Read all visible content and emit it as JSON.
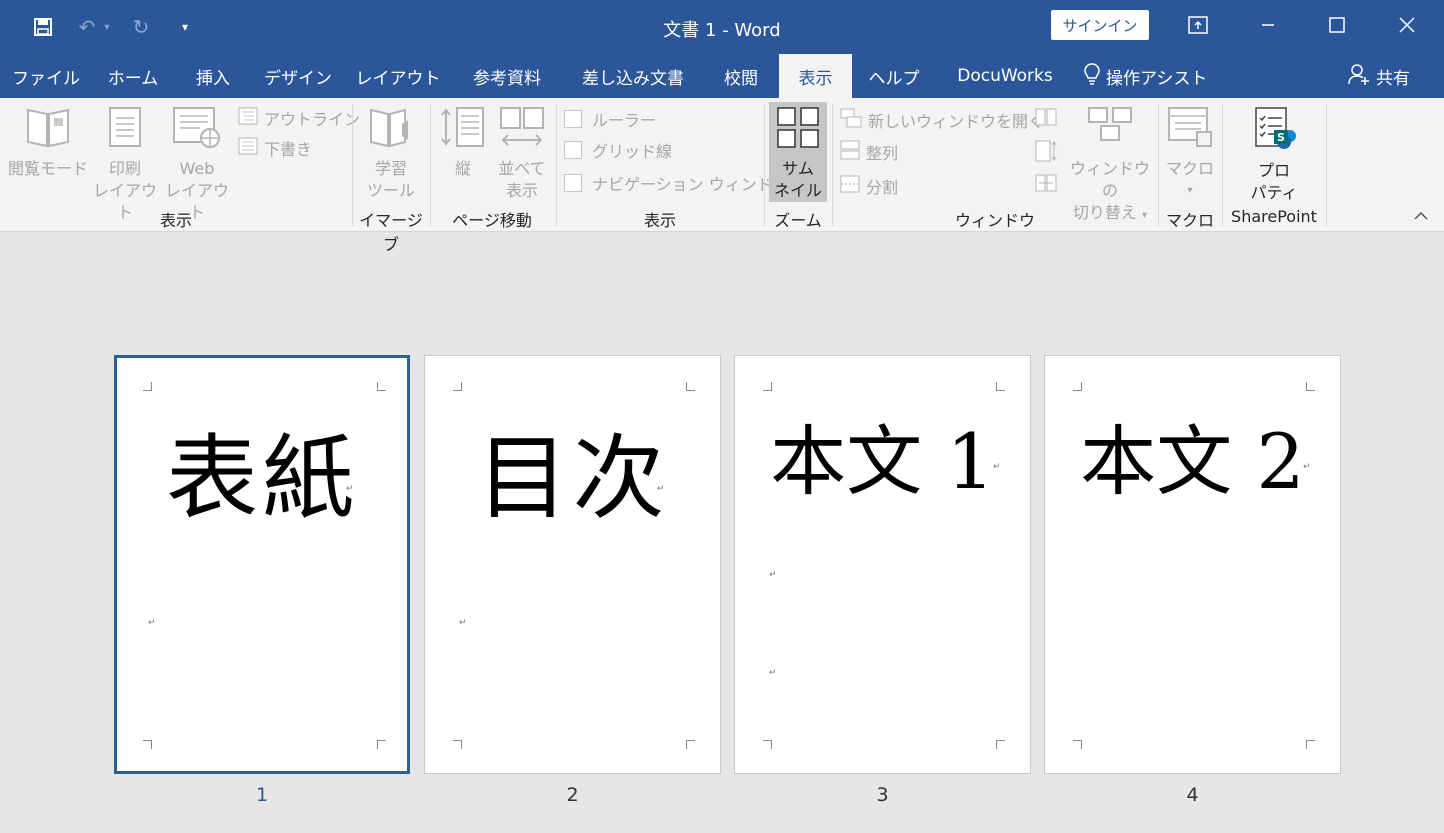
{
  "window": {
    "title": "文書 1  -  Word",
    "signin_label": "サインイン",
    "icons": [
      "save-icon",
      "undo-icon",
      "redo-icon",
      "customize-qat-icon",
      "ribbon-display-icon",
      "minimize-icon",
      "maximize-icon",
      "close-icon"
    ]
  },
  "tabs": [
    "ファイル",
    "ホーム",
    "挿入",
    "デザイン",
    "レイアウト",
    "参考資料",
    "差し込み文書",
    "校閲",
    "表示",
    "ヘルプ",
    "DocuWorks",
    "操作アシスト"
  ],
  "active_tab": "表示",
  "share_label": "共有",
  "ribbon": {
    "views": {
      "read_mode": "閲覧モード",
      "print_layout_1": "印刷",
      "print_layout_2": "レイアウト",
      "web_layout_1": "Web",
      "web_layout_2": "レイアウト",
      "outline": "アウトライン",
      "draft": "下書き",
      "label": "表示"
    },
    "immersive": {
      "learning_1": "学習",
      "learning_2": "ツール",
      "label": "イマージブ"
    },
    "page_movement": {
      "vertical": "縦",
      "side_by_side_1": "並べて",
      "side_by_side_2": "表示",
      "label": "ページ移動"
    },
    "show": {
      "ruler": "ルーラー",
      "gridlines": "グリッド線",
      "navigation": "ナビゲーション ウィンドウ",
      "label": "表示"
    },
    "zoom": {
      "thumbnails_1": "サム",
      "thumbnails_2": "ネイル",
      "label": "ズーム"
    },
    "window": {
      "new_window": "新しいウィンドウを開く",
      "arrange": "整列",
      "split": "分割",
      "switch_1": "ウィンドウの",
      "switch_2": "切り替え",
      "label": "ウィンドウ"
    },
    "macros": {
      "macros": "マクロ",
      "label": "マクロ"
    },
    "sharepoint": {
      "properties_1": "プロ",
      "properties_2": "パティ",
      "label": "SharePoint"
    }
  },
  "pages": [
    {
      "text": "表紙",
      "number": "1",
      "selected": true
    },
    {
      "text": "目次",
      "number": "2",
      "selected": false
    },
    {
      "text": "本文 1",
      "number": "3",
      "selected": false
    },
    {
      "text": "本文 2",
      "number": "4",
      "selected": false
    }
  ],
  "colors": {
    "accent": "#2b579a",
    "selected_border": "#2b5f96",
    "ribbon_bg": "#f3f3f3",
    "canvas_bg": "#e6e6e6"
  }
}
